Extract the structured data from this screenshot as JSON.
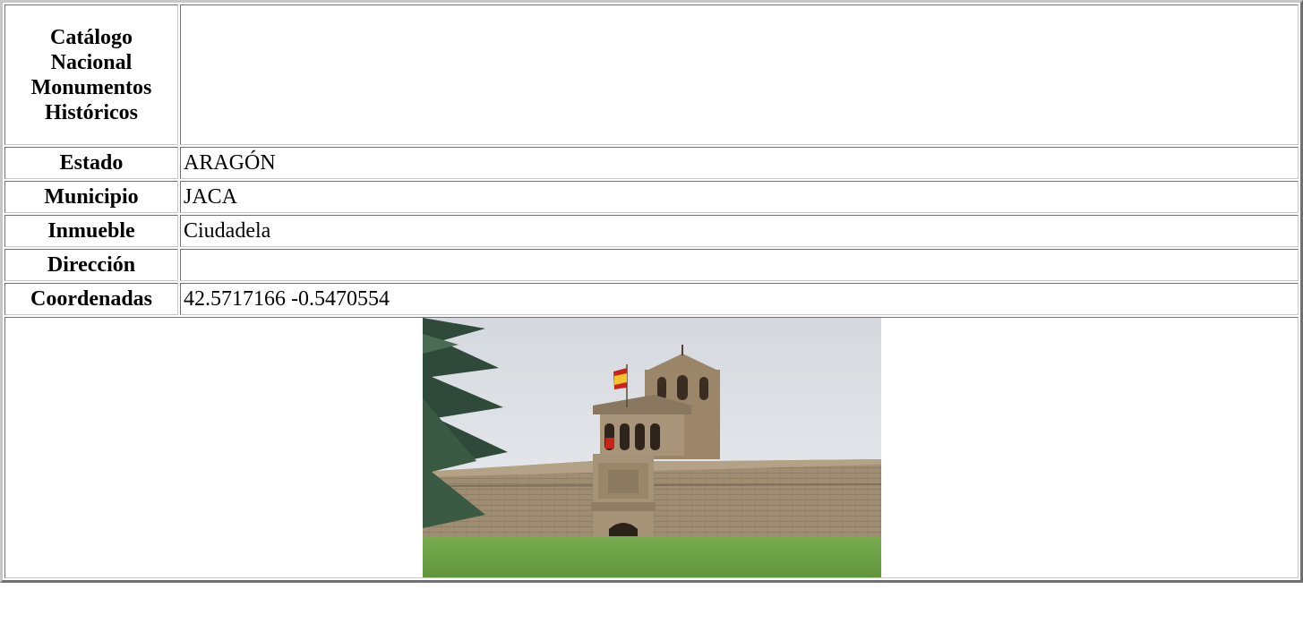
{
  "table": {
    "title": "Catálogo Nacional Monumentos Históricos",
    "title_value": "",
    "rows": [
      {
        "label": "Estado",
        "value": "ARAGÓN"
      },
      {
        "label": "Municipio",
        "value": "JACA"
      },
      {
        "label": "Inmueble",
        "value": "Ciudadela"
      },
      {
        "label": "Dirección",
        "value": ""
      },
      {
        "label": "Coordenadas",
        "value": "42.5717166 -0.5470554"
      }
    ]
  },
  "photo": {
    "subject": "citadel-gate-bell-tower-with-flag"
  },
  "colors": {
    "sky": "#e1e4e8",
    "stone": "#9c8c74",
    "grass": "#6fa347",
    "flag_red": "#c8241c",
    "flag_yellow": "#f4c430"
  }
}
